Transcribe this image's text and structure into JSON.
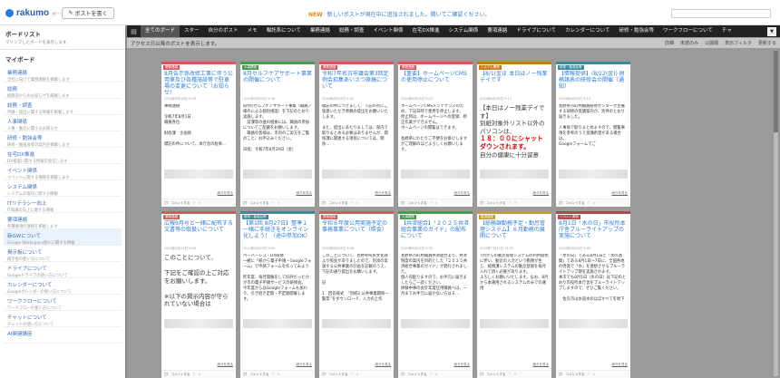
{
  "app": {
    "name": "rakumo",
    "sub": "ボード",
    "post_button": "ポストを書く"
  },
  "notice": {
    "new": "NEW",
    "text": "新しいポストが現在中に追加されました。開いてご確認ください。"
  },
  "sidebar": {
    "title": "ボードリスト",
    "subtitle": "マリシブしたボードを表示します。",
    "section": "マイボード",
    "items": [
      {
        "name": "業務連絡",
        "desc": "全社に向けて業務連絡を掲載します"
      },
      {
        "name": "総務",
        "desc": "総務部からのお知らせを掲載します"
      },
      {
        "name": "総務・調査",
        "desc": "申請・提出に関する情報を掲載します"
      },
      {
        "name": "人事関係",
        "desc": "人事・勤怠に関するお知らせ"
      },
      {
        "name": "研修・勉強会等",
        "desc": "研修・勉強会等の案内を掲載します"
      },
      {
        "name": "在宅DX推進",
        "desc": "DX推進に関する情報を発信します"
      },
      {
        "name": "イベント関係",
        "desc": "イベントに関する情報を掲載します"
      },
      {
        "name": "システム関係",
        "desc": "システムの保守に関する情報"
      },
      {
        "name": "ITリテラシー向上",
        "desc": "IT知識の向上に関する情報"
      },
      {
        "name": "要項連絡",
        "desc": "各種要項の連絡を掲載します"
      },
      {
        "name": "新GWについて",
        "desc": "Google Workspace導入に関する情報"
      },
      {
        "name": "掲示板について",
        "desc": "掲示板の使い方について"
      },
      {
        "name": "ドライブについて",
        "desc": "Googleドライブの使い方について"
      },
      {
        "name": "カレンダーについて",
        "desc": "Googleカレンダーの使い方について"
      },
      {
        "name": "ワークフローについて",
        "desc": "ワークフローの使い方について"
      },
      {
        "name": "チャットについて",
        "desc": "チャットの使い方について"
      },
      {
        "name": "AI関連講座",
        "desc": ""
      }
    ]
  },
  "tabs": [
    "全てのボード",
    "スター",
    "自分のポスト",
    "メモ",
    "嘱託系について",
    "業務連絡",
    "総務・調査",
    "イベント関係",
    "在宅DX推進",
    "システム関係",
    "要項連絡",
    "ドライブについて",
    "カレンダーについて",
    "研修・勉強会等",
    "ワークフローについて",
    "チャ"
  ],
  "subbar": {
    "msg": "アクセス日以降のポストを表示します。",
    "actions": [
      "詳細",
      "未読のみ",
      "公開順",
      "表示フィルタ",
      "更新する"
    ]
  },
  "cards": [
    {
      "cat": "業務連絡",
      "title": "8月告示係改修工事に伴う公用車及び各種施設等で駐車場の変更について（お知らせ）",
      "meta": "2024年8月18日 9:50",
      "body": "事務連絡\n\n令和7年8月1日\n職員各位\n\n財政課　企画係\n\n標記の件について、本庁舎の駐車...",
      "read": "続きを見る",
      "comment": "コメントする"
    },
    {
      "cat": "人事関係",
      "title": "8月セルフケアサポート事業の開催について",
      "meta": "2024年8月18日 9:46",
      "body": "8月のセルフケアサポート事業（職員ノ様のによる個別相談）を下記のとおり実施します。\n　前課等の昼の個食には、職員の参加についてご配慮をお願いします。\n　職員の皆様は、市内のご実方をご覧のこと、お申込みください。\n\n日程：令和7年8月29日（金）",
      "read": "続きを見る",
      "comment": "コメントする"
    },
    {
      "cat": "業務連絡",
      "title": "令和7年名古市議会第3回定例会招集あいさつ原稿について",
      "meta": "2024年8月18日 9:32",
      "body": "標記の件につきまして、下記の点にご留意いただき原稿の提出をお願いいたします。\n\nまた、提出にあたりましては、部内で取りまとめる必要はありませんが、関係課に関連する項目については、関係...",
      "read": "続きを見る",
      "comment": "コメントする"
    },
    {
      "cat": "業務連絡",
      "title": "【重要】ホームページCMSの使用停止について",
      "meta": "2024年8月18日 9:23",
      "body": "ホームページCMSメンテナンスのため、下記日時で使用を停止します。\n停止時は、ホームページへの登録、修正作業ができません。\nホームページの閲覧はできます。\n\n長崎県にわたりご不便をお掛けしますがご理解のほどよろしくお願いします。",
      "read": "続きを見る",
      "comment": "コメントする"
    },
    {
      "cat": "システム関係",
      "title": "【8/1(金)】本日はノー残業デイです",
      "meta": "2024年8月18日 9:11",
      "body": "【本日はノー残業デイです】\n別紙対象外リスト以外のパソコンは、",
      "red": "１８：００にシャットダウンされます。",
      "tail": "自分の健康に十分留意",
      "read": "続きを見る",
      "comment": "コメントする"
    },
    {
      "cat": "研修・勉強会等",
      "title": "【情報提供】(8/22(金)) 財務諸表の研修会の開催（通知）",
      "meta": "2024年8月18日 9:10",
      "body": "長野県市町村職員研修センターが主催する研修の受講案内が、別件のとおり届きました。\n\n人事係で取りまとめますので、閲覧事項を参考のうえ受講希望がある場合は、\nGoogleフォームでご",
      "read": "続きを見る",
      "comment": "コメントする"
    },
    {
      "cat": "業務連絡",
      "title": "広報9月号と一緒に配布する文書等の取扱いについて",
      "meta": "2024年8月11日 9:50",
      "body": "このことについて、\n\n下記をご確認の上ご対応をお願いします。\n\n※以下の掲示内容が守られていない場合は",
      "big": true,
      "read": "続きを見る",
      "comment": "コメントする"
    },
    {
      "cat": "研修・勉強会等",
      "title": "【第1回 8月27日】整準１一緒に手続きをオンライン化しよう！（途中参加OK）",
      "meta": "2024年8月18日 9:55",
      "body": "ペーパーレス・DX研修\n一緒に「紙から電子申請・Googleフォーム」で申請フォームを作ってみよう\n\n昨年度、毎月開催をして好評だったかが市の電子申請サービスの研修会。\n今年度からはGoogleフォームも加わり、引き続き定期・不定期開催します。",
      "read": "続きを見る",
      "comment": "コメントする"
    },
    {
      "cat": "業務連絡",
      "title": "令和８年度公用実施予定の事務事業について（照会）",
      "meta": "2024年8月18日 9:48",
      "body": "このことについて、長野県県民文化部より照会がありましたので、別添の実施する公共事業の計画を記載のうえ、下記の通り提出をお願いします。\n\n記\n\n1　回答様式　“別紙2 公共事業関係一覧票”をダウンロード、入力の上作",
      "read": "続きを見る",
      "comment": "コメントする"
    },
    {
      "cat": "人事関係",
      "title": "【共済組合】「２０２５共済組合事業のガイド」の配布について",
      "meta": "2024年8月18日 9:35",
      "body": "長野県市町村職員共済組合より、共済制度の案内を目的とした「２０２５共済組合事業のガイド」が発行されました。\n個人宛配りますので、お手元に届きましたらご一読ください。\n体験中事の会計年度任用職員へは、一月までお手元に届かない方はＥ...",
      "read": "続きを見る",
      "comment": "コメントする"
    },
    {
      "cat": "要項連絡",
      "title": "【総務課勤務予定・勤怠管理システム】８月勤務の展開について",
      "meta": "2024年7月31日 15:51",
      "body": "7月からの勤怠管理システムの利用開始に伴い、勤怠の入力という勤務が生じ、総務課システムの勤怠登録を毎月入れて頂く必要があります。\nよろしくお願いいたします。なお、8月から本運用されるシステムのみでの運用",
      "read": "続きを見る",
      "comment": "コメントする"
    },
    {
      "cat": "イベント関係",
      "title": "8月1日「水の日」市役所本庁舎ブルーライトアップの実施について",
      "meta": "2024年8月18日 9:45",
      "body": "「水の日」である8月1日と「水の週間」である8月1日〜7日に、全国各地の啓発で「水」を連想させるブルーライトアップ期を実施されます。\n本市でも8月1日（水の日）は下記のとおり市役所本庁舎をブルーライトアップしますので、ぜひご覧ください。\n\n　佐久市は水道水のほぼすべてを地下",
      "read": "続きを見る",
      "comment": "コメントする"
    }
  ]
}
